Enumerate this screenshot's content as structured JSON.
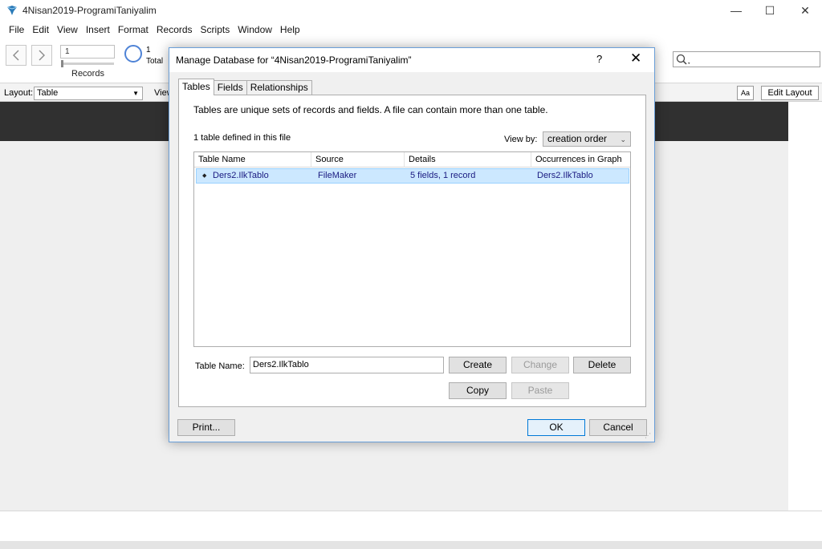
{
  "app": {
    "title": "4Nisan2019-ProgramiTaniyalim",
    "win_min": "—",
    "win_max": "☐",
    "win_close": "✕"
  },
  "menu": [
    "File",
    "Edit",
    "View",
    "Insert",
    "Format",
    "Records",
    "Scripts",
    "Window",
    "Help"
  ],
  "toolbar": {
    "record_value": "1",
    "records_label": "Records",
    "total_count": "1",
    "total_label": "Total",
    "search_icon": "search-icon"
  },
  "layoutbar": {
    "layout_label": "Layout:",
    "layout_value": "Table",
    "view_label": "View",
    "aa_label": "Aa",
    "edit_layout_label": "Edit Layout"
  },
  "dialog": {
    "title": "Manage Database for “4Nisan2019-ProgramiTaniyalim”",
    "help": "?",
    "close": "✕",
    "tabs": [
      "Tables",
      "Fields",
      "Relationships"
    ],
    "description": "Tables are unique sets of records and fields. A file can contain more than one table.",
    "count_text": "1 table defined in this file",
    "view_by_label": "View by:",
    "view_by_value": "creation order",
    "columns": [
      "Table Name",
      "Source",
      "Details",
      "Occurrences in Graph"
    ],
    "rows": [
      {
        "name": "Ders2.IlkTablo",
        "source": "FileMaker",
        "details": "5 fields, 1 record",
        "occurrences": "Ders2.IlkTablo"
      }
    ],
    "table_name_label": "Table Name:",
    "table_name_value": "Ders2.IlkTablo",
    "buttons": {
      "create": "Create",
      "change": "Change",
      "delete": "Delete",
      "copy": "Copy",
      "paste": "Paste",
      "print": "Print...",
      "ok": "OK",
      "cancel": "Cancel"
    }
  },
  "colors": {
    "selection": "#cce8ff",
    "dialog_border": "#6a9fd8",
    "dark_band": "#303030"
  }
}
